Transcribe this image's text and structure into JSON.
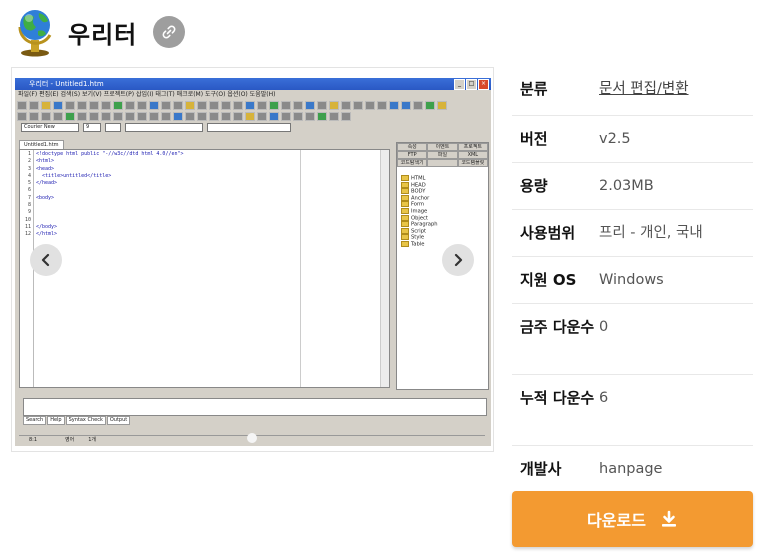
{
  "app": {
    "title": "우리터",
    "icon": "globe-icon",
    "link_icon": "link-icon"
  },
  "screenshot": {
    "window_title": "우리터 - Untitled1.htm",
    "menu": "파일(F)  편집(E)  검색(S)  보기(V)  프로젝트(P)  삽입(I)  태그(T)  매크로(M)  도구(O)  옵션(O)  도움말(H)",
    "font_name": "Courier New",
    "font_size": "9",
    "doc_tab": "Untitled1.htm",
    "line_numbers": "1\n2\n3\n4\n5\n6\n7\n8\n9\n10\n11\n12",
    "code": "<!doctype html public \"-//w3c//dtd html 4.0//en\">\n<html>\n<head>\n  <title>untitled</title>\n</head>\n\n<body>\n\n\n\n</body>\n</html>",
    "side_tabs": [
      "속성",
      "이벤트",
      "프로젝트",
      "FTP",
      "파일",
      "XML",
      "코드탐색기",
      "",
      "코드템플릿"
    ],
    "tree": [
      "HTML",
      "HEAD",
      "BODY",
      "Anchor",
      "Form",
      "Image",
      "Object",
      "Paragraph",
      "Script",
      "Style",
      "Table"
    ],
    "bottom_tabs": [
      "Search",
      "Help",
      "Syntax Check",
      "Output"
    ],
    "status": [
      "8:1",
      "",
      "영어",
      "1개"
    ]
  },
  "gallery": {
    "prev_icon": "chevron-left-icon",
    "next_icon": "chevron-right-icon"
  },
  "info": [
    {
      "label": "분류",
      "value": "문서 편집/변환",
      "link": true
    },
    {
      "label": "버전",
      "value": "v2.5"
    },
    {
      "label": "용량",
      "value": "2.03MB"
    },
    {
      "label": "사용범위",
      "value": "프리 - 개인, 국내"
    },
    {
      "label": "지원 OS",
      "value": "Windows"
    },
    {
      "label": "금주 다운수",
      "value": "0"
    },
    {
      "label": "누적 다운수",
      "value": "6"
    },
    {
      "label": "개발사",
      "value": "hanpage"
    }
  ],
  "download": {
    "label": "다운로드",
    "icon": "download-icon"
  },
  "colors": {
    "accent": "#f39a31",
    "link_button": "#9e9e9e"
  }
}
